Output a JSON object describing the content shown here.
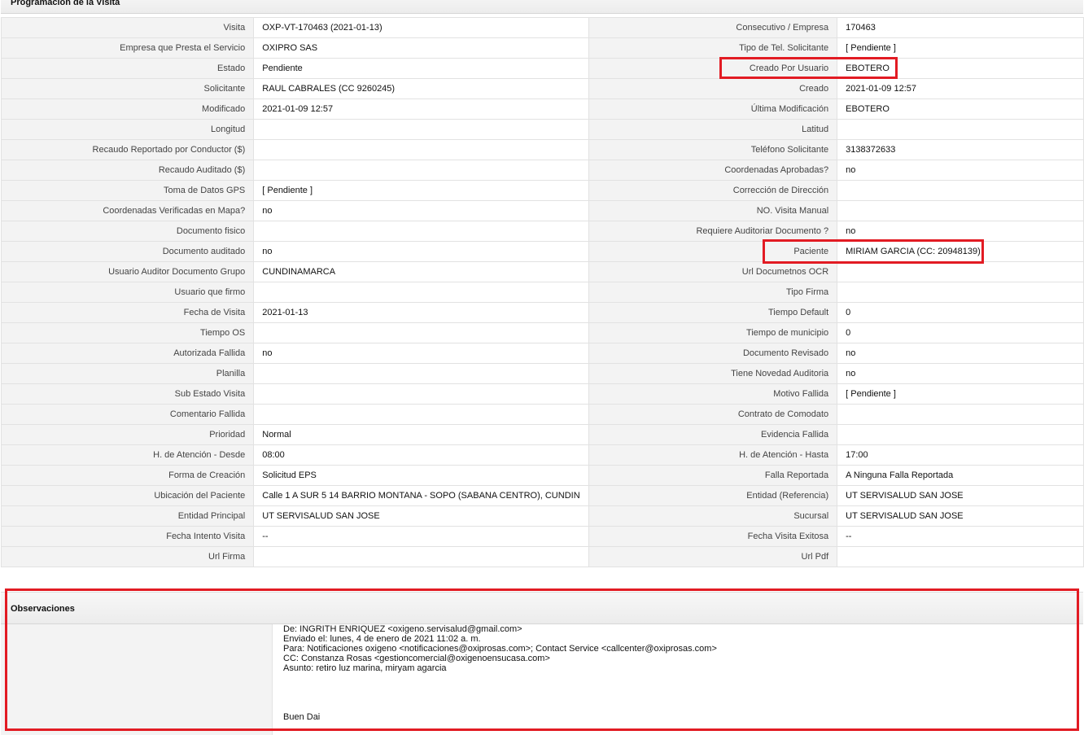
{
  "section_title": "Programación de la Visita",
  "rows": [
    {
      "l1": "Visita",
      "v1": "OXP-VT-170463 (2021-01-13)",
      "l2": "Consecutivo / Empresa",
      "v2": "170463"
    },
    {
      "l1": "Empresa que Presta el Servicio",
      "v1": "OXIPRO SAS",
      "l2": "Tipo de Tel. Solicitante",
      "v2": "[ Pendiente ]"
    },
    {
      "l1": "Estado",
      "v1": "Pendiente",
      "l2": "Creado Por Usuario",
      "v2": "EBOTERO"
    },
    {
      "l1": "Solicitante",
      "v1": "RAUL CABRALES (CC 9260245)",
      "l2": "Creado",
      "v2": "2021-01-09 12:57"
    },
    {
      "l1": "Modificado",
      "v1": "2021-01-09 12:57",
      "l2": "Última Modificación",
      "v2": " EBOTERO"
    },
    {
      "l1": "Longitud",
      "v1": "",
      "l2": "Latitud",
      "v2": ""
    },
    {
      "l1": "Recaudo Reportado por Conductor ($)",
      "v1": "",
      "l2": "Teléfono Solicitante",
      "v2": "3138372633"
    },
    {
      "l1": "Recaudo Auditado ($)",
      "v1": "",
      "l2": "Coordenadas Aprobadas?",
      "v2": " no"
    },
    {
      "l1": "Toma de Datos GPS",
      "v1": "[ Pendiente ]",
      "l2": "Corrección de Dirección",
      "v2": ""
    },
    {
      "l1": "Coordenadas Verificadas en Mapa?",
      "v1": " no",
      "l2": "NO. Visita Manual",
      "v2": ""
    },
    {
      "l1": "Documento fisico",
      "v1": "",
      "l2": "Requiere Auditoriar Documento ?",
      "v2": " no"
    },
    {
      "l1": "Documento auditado",
      "v1": " no",
      "l2": "Paciente",
      "v2": "MIRIAM GARCIA (CC: 20948139)"
    },
    {
      "l1": "Usuario Auditor Documento Grupo",
      "v1": "CUNDINAMARCA",
      "l2": "Url Documetnos OCR",
      "v2": ""
    },
    {
      "l1": "Usuario que firmo",
      "v1": "",
      "l2": "Tipo Firma",
      "v2": ""
    },
    {
      "l1": "Fecha de Visita",
      "v1": " 2021-01-13",
      "l2": "Tiempo Default",
      "v2": "0"
    },
    {
      "l1": "Tiempo OS",
      "v1": "",
      "l2": "Tiempo de municipio",
      "v2": "0"
    },
    {
      "l1": "Autorizada Fallida",
      "v1": " no",
      "l2": "Documento Revisado",
      "v2": " no"
    },
    {
      "l1": "Planilla",
      "v1": "",
      "l2": "Tiene Novedad Auditoria",
      "v2": " no"
    },
    {
      "l1": "Sub Estado Visita",
      "v1": "",
      "l2": "Motivo Fallida",
      "v2": "[ Pendiente ]"
    },
    {
      "l1": "Comentario Fallida",
      "v1": "",
      "l2": "Contrato de Comodato",
      "v2": ""
    },
    {
      "l1": "Prioridad",
      "v1": "Normal",
      "l2": "Evidencia Fallida",
      "v2": ""
    },
    {
      "l1": "H. de Atención - Desde",
      "v1": "08:00",
      "l2": "H. de Atención - Hasta",
      "v2": "17:00"
    },
    {
      "l1": "Forma de Creación",
      "v1": "Solicitud EPS",
      "l2": "Falla Reportada",
      "v2": "A Ninguna Falla Reportada"
    },
    {
      "l1": "Ubicación del Paciente",
      "v1": "Calle 1 A SUR 5 14 BARRIO MONTANA - SOPO (SABANA CENTRO), CUNDIN",
      "l2": "Entidad (Referencia)",
      "v2": "UT SERVISALUD SAN JOSE"
    },
    {
      "l1": "Entidad Principal",
      "v1": "UT SERVISALUD SAN JOSE",
      "l2": "Sucursal",
      "v2": "UT SERVISALUD SAN JOSE"
    },
    {
      "l1": "Fecha Intento Visita",
      "v1": " --",
      "l2": "Fecha Visita Exitosa",
      "v2": " --"
    },
    {
      "l1": "Url Firma",
      "v1": "",
      "l2": "Url Pdf",
      "v2": ""
    }
  ],
  "observaciones": {
    "title": "Observaciones",
    "lines": [
      " De: INGRITH ENRIQUEZ <oxigeno.servisalud@gmail.com>",
      "Enviado el: lunes, 4 de enero de 2021 11:02 a. m.",
      "Para: Notificaciones oxigeno <notificaciones@oxiprosas.com>; Contact Service <callcenter@oxiprosas.com>",
      "CC: Constanza Rosas <gestioncomercial@oxigenoensucasa.com>",
      "Asunto: retiro luz marina, miryam agarcia",
      "Buen Dai"
    ]
  },
  "colors": {
    "highlight": "#e21b23",
    "label_bg": "#f3f3f3",
    "header_bg": "#ececec"
  }
}
